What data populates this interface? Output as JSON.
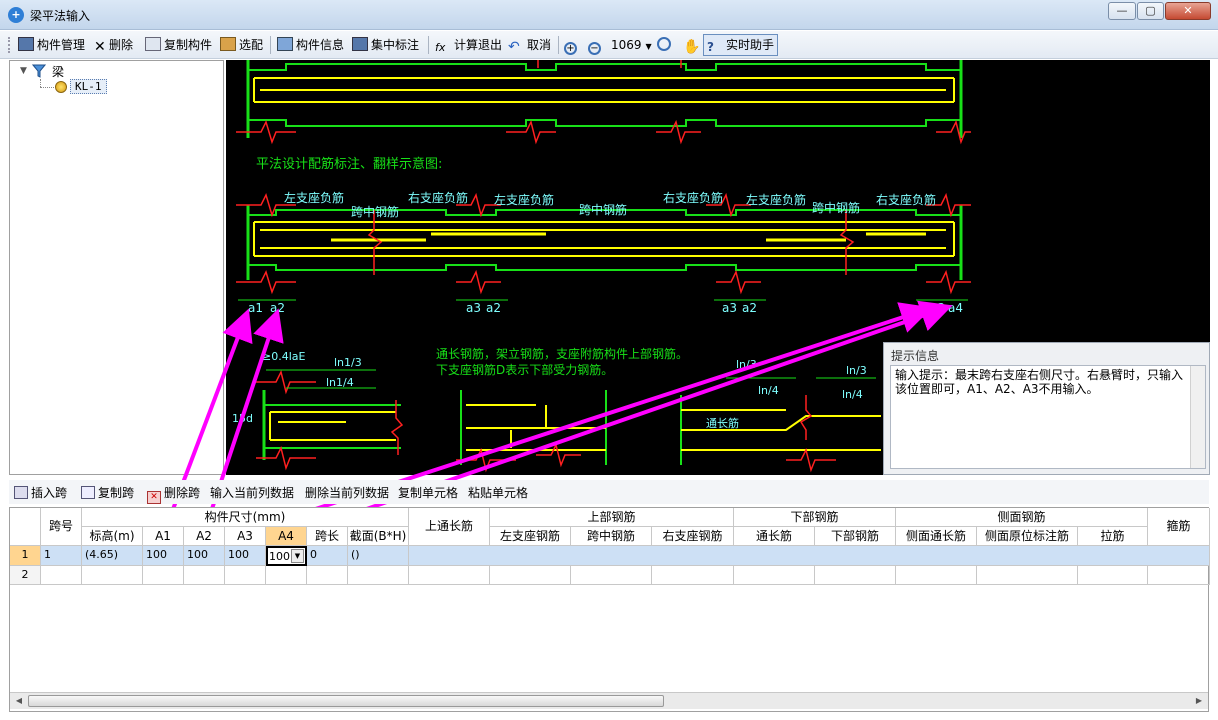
{
  "window": {
    "title": "梁平法输入",
    "min": "—",
    "max": "▢",
    "close": "✕"
  },
  "toolbar": {
    "manage": "构件管理",
    "delete": "删除",
    "copy": "复制构件",
    "pick": "选配",
    "info": "构件信息",
    "annotate": "集中标注",
    "calc_exit": "计算退出",
    "cancel": "取消",
    "zoom": "1069",
    "assistant": "实时助手"
  },
  "tree": {
    "root": "梁",
    "child": "KL-1"
  },
  "drawing": {
    "heading": "平法设计配筋标注、翻样示意图:",
    "labels": {
      "left_neg_1": "左支座负筋",
      "right_neg_1": "右支座负筋",
      "left_neg_2": "左支座负筋",
      "right_neg_2": "右支座负筋",
      "left_neg_3": "左支座负筋",
      "right_neg_3": "右支座负筋",
      "mid_1": "跨中钢筋",
      "mid_2": "跨中钢筋",
      "mid_3": "跨中钢筋",
      "a1": "a1",
      "a2": "a2",
      "a3": "a3",
      "a4": "a4",
      "note1": "通长钢筋，架立钢筋，支座附筋构件上部钢筋。",
      "note2": "下支座钢筋D表示下部受力钢筋。",
      "lae": "≥0.4laE",
      "ln13": "ln1/3",
      "ln14": "ln1/4",
      "n15": "15d",
      "ln3": "ln/3",
      "ln4a": "ln/4",
      "ln4b": "ln/4",
      "ln3b": "ln/3",
      "through": "通长筋"
    }
  },
  "hint": {
    "title": "提示信息",
    "text": "输入提示：最末跨右支座右侧尺寸。右悬臂时，只输入该位置即可，A1、A2、A3不用输入。"
  },
  "toolbar2": {
    "insert": "插入跨",
    "copy": "复制跨",
    "delete": "删除跨",
    "input_col": "输入当前列数据",
    "delete_col": "删除当前列数据",
    "copy_cell": "复制单元格",
    "paste_cell": "粘贴单元格"
  },
  "grid": {
    "groups": {
      "span_no": "跨号",
      "dims": "构件尺寸(mm)",
      "top_through": "上通长筋",
      "top_rebar": "上部钢筋",
      "bottom_rebar": "下部钢筋",
      "side_rebar": "侧面钢筋",
      "stirrup": "箍筋"
    },
    "sub": {
      "elev": "标高(m)",
      "a1": "A1",
      "a2": "A2",
      "a3": "A3",
      "a4": "A4",
      "span_len": "跨长",
      "section": "截面(B*H)",
      "left_neg": "左支座钢筋",
      "mid": "跨中钢筋",
      "right_neg": "右支座钢筋",
      "through": "通长筋",
      "bottom": "下部钢筋",
      "side_through": "侧面通长筋",
      "side_orig": "侧面原位标注筋",
      "tie": "拉筋"
    },
    "rows": [
      {
        "idx": "1",
        "span": "1",
        "elev": "(4.65)",
        "a1": "100",
        "a2": "100",
        "a3": "100",
        "a4": "100",
        "span_len": "0",
        "section": "()"
      },
      {
        "idx": "2",
        "span": "",
        "elev": "",
        "a1": "",
        "a2": "",
        "a3": "",
        "a4": "",
        "span_len": "",
        "section": ""
      }
    ]
  },
  "colors": {
    "green": "#18e018",
    "yellow": "#ffff00",
    "red": "#ff2020",
    "cyan": "#7fffff",
    "magenta": "#ff00ff"
  }
}
